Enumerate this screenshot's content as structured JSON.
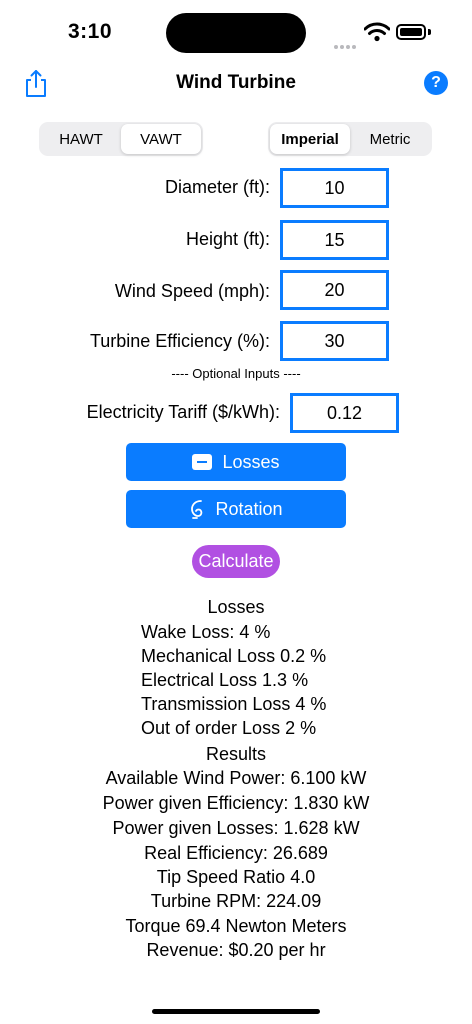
{
  "status": {
    "time": "3:10"
  },
  "nav": {
    "title": "Wind Turbine",
    "share_icon": "share-icon",
    "help_label": "?"
  },
  "turbine_type": {
    "options": [
      "HAWT",
      "VAWT"
    ],
    "selected": "VAWT"
  },
  "units": {
    "options": [
      "Imperial",
      "Metric"
    ],
    "selected": "Imperial"
  },
  "inputs": {
    "diameter": {
      "label": "Diameter (ft):",
      "value": "10"
    },
    "height": {
      "label": "Height (ft):",
      "value": "15"
    },
    "wind_speed": {
      "label": "Wind Speed (mph):",
      "value": "20"
    },
    "efficiency": {
      "label": "Turbine Efficiency (%):",
      "value": "30"
    }
  },
  "optional": {
    "header": "---- Optional Inputs ----",
    "tariff": {
      "label": "Electricity Tariff ($/kWh):",
      "value": "0.12"
    }
  },
  "buttons": {
    "losses": "Losses",
    "rotation": "Rotation",
    "calculate": "Calculate"
  },
  "losses": {
    "title": "Losses",
    "items": [
      "Wake Loss: 4 %",
      "Mechanical Loss 0.2 %",
      "Electrical Loss 1.3 %",
      "Transmission Loss 4 %",
      "Out of order Loss 2 %"
    ]
  },
  "results": {
    "title": "Results",
    "items": [
      "Available Wind Power: 6.100 kW",
      "Power given Efficiency: 1.830 kW",
      "Power given Losses: 1.628 kW",
      "Real Efficiency: 26.689",
      "Tip Speed Ratio 4.0",
      "Turbine RPM: 224.09",
      "Torque 69.4 Newton Meters",
      "Revenue: $0.20 per hr"
    ]
  },
  "colors": {
    "accent": "#0a7cff",
    "calculate": "#b150e2"
  }
}
